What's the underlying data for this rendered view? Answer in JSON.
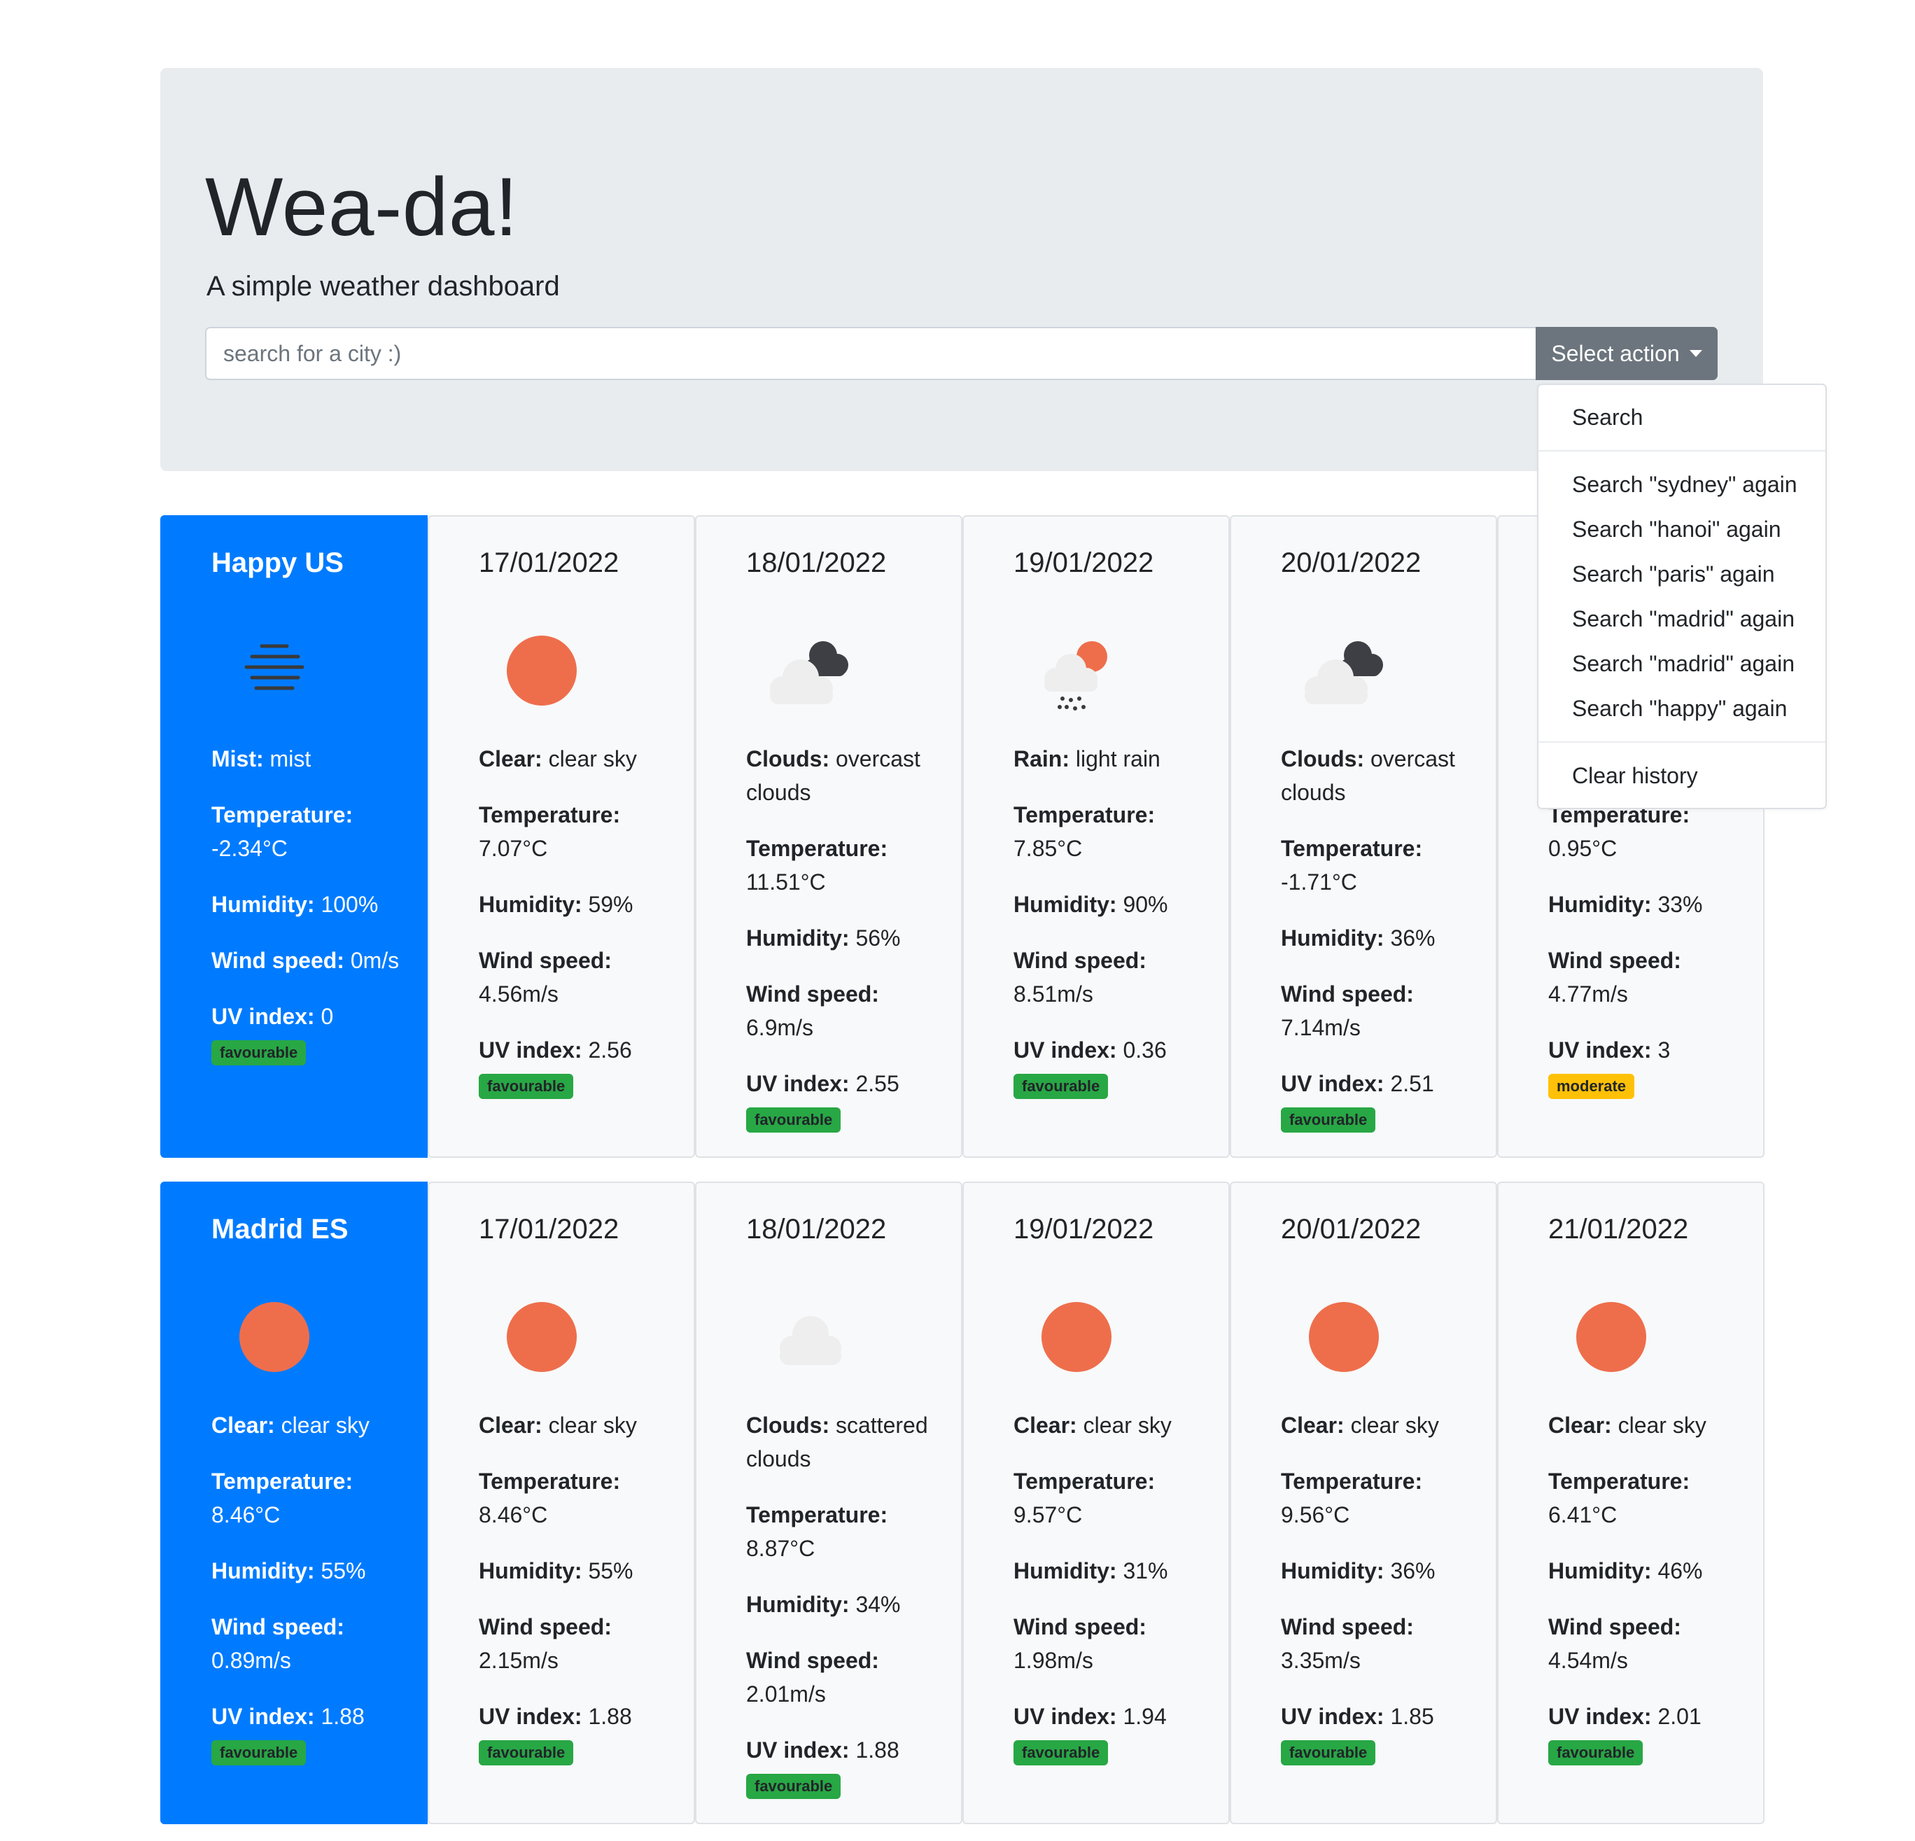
{
  "header": {
    "title": "Wea-da!",
    "subtitle": "A simple weather dashboard",
    "search_placeholder": "search for a city :)",
    "action_button": "Select action"
  },
  "dropdown": {
    "search": "Search",
    "history": [
      "Search \"sydney\" again",
      "Search \"hanoi\" again",
      "Search \"paris\" again",
      "Search \"madrid\" again",
      "Search \"madrid\" again",
      "Search \"happy\" again"
    ],
    "clear": "Clear history"
  },
  "labels": {
    "temperature": "Temperature:",
    "humidity": "Humidity:",
    "wind": "Wind speed:",
    "uv": "UV index:"
  },
  "colors": {
    "city_card": "#007bff",
    "favourable": "#28a745",
    "moderate": "#ffc107",
    "sun": "#ee6e4c"
  },
  "rows": [
    {
      "cards": [
        {
          "title": "Happy US",
          "icon": "mist-icon",
          "cond": "Mist:",
          "desc": "mist",
          "temp": "-2.34°C",
          "hum": "100%",
          "wind": "0m/s",
          "uv": "0",
          "uv_badge": "favourable",
          "uv_level": "fav"
        },
        {
          "title": "17/01/2022",
          "icon": "sun-icon",
          "cond": "Clear:",
          "desc": "clear sky",
          "temp": "7.07°C",
          "hum": "59%",
          "wind": "4.56m/s",
          "uv": "2.56",
          "uv_badge": "favourable",
          "uv_level": "fav"
        },
        {
          "title": "18/01/2022",
          "icon": "broken-clouds-icon",
          "cond": "Clouds:",
          "desc": "overcast clouds",
          "temp": "11.51°C",
          "hum": "56%",
          "wind": "6.9m/s",
          "uv": "2.55",
          "uv_badge": "favourable",
          "uv_level": "fav"
        },
        {
          "title": "19/01/2022",
          "icon": "rain-icon",
          "cond": "Rain:",
          "desc": "light rain",
          "temp": "7.85°C",
          "hum": "90%",
          "wind": "8.51m/s",
          "uv": "0.36",
          "uv_badge": "favourable",
          "uv_level": "fav"
        },
        {
          "title": "20/01/2022",
          "icon": "broken-clouds-icon",
          "cond": "Clouds:",
          "desc": "overcast clouds",
          "temp": "-1.71°C",
          "hum": "36%",
          "wind": "7.14m/s",
          "uv": "2.51",
          "uv_badge": "favourable",
          "uv_level": "fav"
        },
        {
          "title": "",
          "icon": "",
          "cond": "",
          "desc": "",
          "temp": "0.95°C",
          "hum": "33%",
          "wind": "4.77m/s",
          "uv": "3",
          "uv_badge": "moderate",
          "uv_level": "mod"
        }
      ]
    },
    {
      "cards": [
        {
          "title": "Madrid ES",
          "icon": "sun-icon",
          "cond": "Clear:",
          "desc": "clear sky",
          "temp": "8.46°C",
          "hum": "55%",
          "wind": "0.89m/s",
          "uv": "1.88",
          "uv_badge": "favourable",
          "uv_level": "fav"
        },
        {
          "title": "17/01/2022",
          "icon": "sun-icon",
          "cond": "Clear:",
          "desc": "clear sky",
          "temp": "8.46°C",
          "hum": "55%",
          "wind": "2.15m/s",
          "uv": "1.88",
          "uv_badge": "favourable",
          "uv_level": "fav"
        },
        {
          "title": "18/01/2022",
          "icon": "cloud-icon",
          "cond": "Clouds:",
          "desc": "scattered clouds",
          "temp": "8.87°C",
          "hum": "34%",
          "wind": "2.01m/s",
          "uv": "1.88",
          "uv_badge": "favourable",
          "uv_level": "fav"
        },
        {
          "title": "19/01/2022",
          "icon": "sun-icon",
          "cond": "Clear:",
          "desc": "clear sky",
          "temp": "9.57°C",
          "hum": "31%",
          "wind": "1.98m/s",
          "uv": "1.94",
          "uv_badge": "favourable",
          "uv_level": "fav"
        },
        {
          "title": "20/01/2022",
          "icon": "sun-icon",
          "cond": "Clear:",
          "desc": "clear sky",
          "temp": "9.56°C",
          "hum": "36%",
          "wind": "3.35m/s",
          "uv": "1.85",
          "uv_badge": "favourable",
          "uv_level": "fav"
        },
        {
          "title": "21/01/2022",
          "icon": "sun-icon",
          "cond": "Clear:",
          "desc": "clear sky",
          "temp": "6.41°C",
          "hum": "46%",
          "wind": "4.54m/s",
          "uv": "2.01",
          "uv_badge": "favourable",
          "uv_level": "fav"
        }
      ]
    }
  ]
}
